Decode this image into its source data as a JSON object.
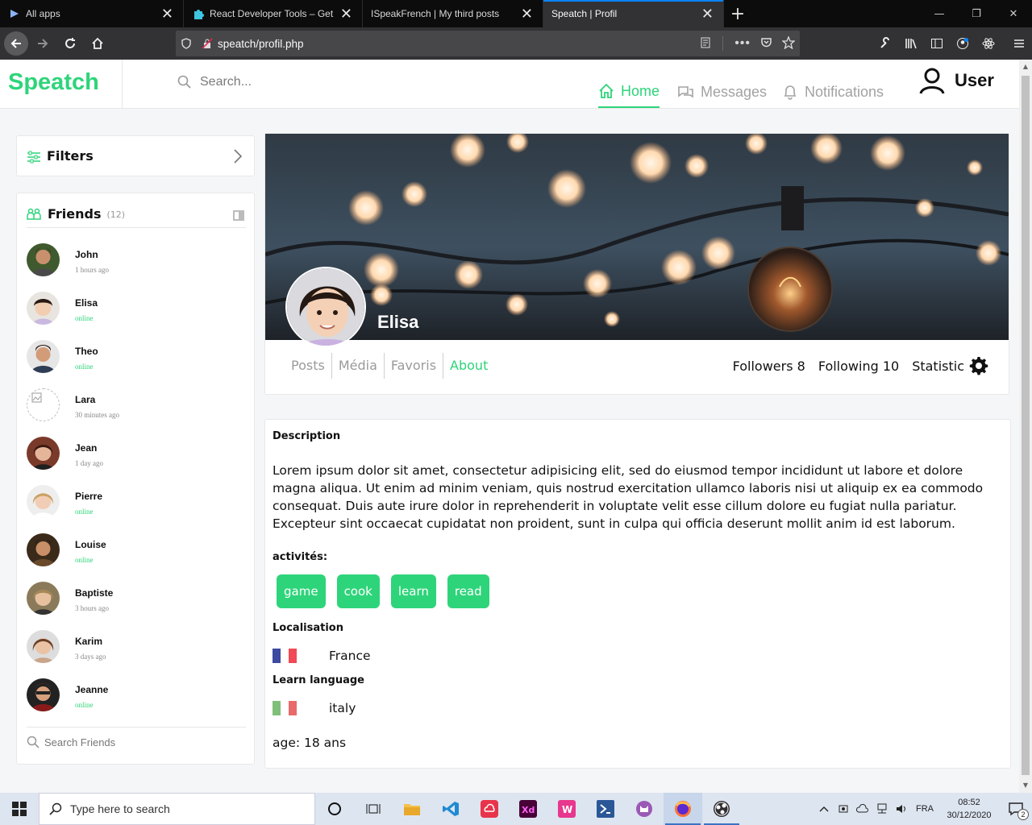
{
  "browser": {
    "tabs": [
      {
        "title": "All apps",
        "active": false
      },
      {
        "title": "React Developer Tools – Get thi",
        "active": false
      },
      {
        "title": "ISpeakFrench | My third posts",
        "active": false
      },
      {
        "title": "Speatch | Profil",
        "active": true
      }
    ],
    "url": "speatch/profil.php"
  },
  "site": {
    "logo": "Speatch",
    "search_placeholder": "Search...",
    "menu": {
      "home": "Home",
      "messages": "Messages",
      "notifications": "Notifications"
    },
    "user": "User"
  },
  "sidebar": {
    "filters_label": "Filters",
    "friends_title": "Friends",
    "friends_count": "(12)",
    "friends": [
      {
        "name": "John",
        "status": "1 hours ago",
        "online": false
      },
      {
        "name": "Elisa",
        "status": "online",
        "online": true
      },
      {
        "name": "Theo",
        "status": "online",
        "online": true
      },
      {
        "name": "Lara",
        "status": "30 minutes ago",
        "online": false
      },
      {
        "name": "Jean",
        "status": "1 day ago",
        "online": false
      },
      {
        "name": "Pierre",
        "status": "online",
        "online": true
      },
      {
        "name": "Louise",
        "status": "online",
        "online": true
      },
      {
        "name": "Baptiste",
        "status": "3 hours ago",
        "online": false
      },
      {
        "name": "Karim",
        "status": "3 days ago",
        "online": false
      },
      {
        "name": "Jeanne",
        "status": "online",
        "online": true
      }
    ],
    "search_friends": "Search Friends"
  },
  "profile": {
    "name": "Elisa",
    "tabs": [
      "Posts",
      "Média",
      "Favoris",
      "About"
    ],
    "active_tab": "About",
    "followers": "Followers 8",
    "following": "Following 10",
    "statistic": "Statistic"
  },
  "about": {
    "description_label": "Description",
    "description": "Lorem ipsum dolor sit amet, consectetur adipisicing elit, sed do eiusmod tempor incididunt ut labore et dolore magna aliqua. Ut enim ad minim veniam, quis nostrud exercitation ullamco laboris nisi ut aliquip ex ea commodo consequat. Duis aute irure dolor in reprehenderit in voluptate velit esse cillum dolore eu fugiat nulla pariatur. Excepteur sint occaecat cupidatat non proident, sunt in culpa qui officia deserunt mollit anim id est laborum.",
    "activities_label": "activités:",
    "activities": [
      "game",
      "cook",
      "learn",
      "read"
    ],
    "localisation_label": "Localisation",
    "localisation": "France",
    "learn_label": "Learn language",
    "learn_language": "italy",
    "age": "age: 18 ans"
  },
  "taskbar": {
    "search_placeholder": "Type here to search",
    "language": "FRA",
    "time": "08:52",
    "date": "30/12/2020",
    "notifications": "2"
  },
  "colors": {
    "accent": "#2ed47a",
    "chrome": "#323234"
  }
}
